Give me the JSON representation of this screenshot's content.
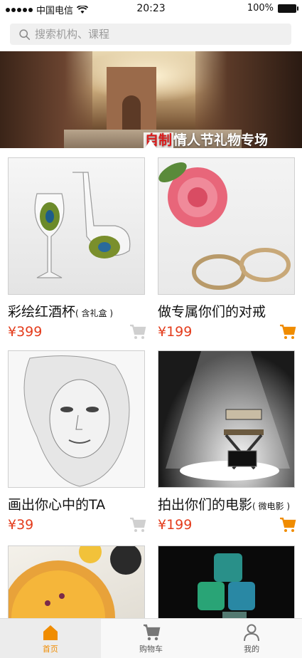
{
  "status_bar": {
    "carrier": "中国电信",
    "time": "20:23",
    "battery": "100%"
  },
  "search": {
    "placeholder": "搜索机构、课程"
  },
  "banner": {
    "title_accent": "自制",
    "title_main": "情人节礼物专场"
  },
  "products": [
    {
      "name": "彩绘红酒杯",
      "note": "( 含礼盒 )",
      "price": "¥399",
      "cart_active": false
    },
    {
      "name": "做专属你们的对戒",
      "note": "",
      "price": "¥199",
      "cart_active": true
    },
    {
      "name": "画出你心中的TA",
      "note": "",
      "price": "¥39",
      "cart_active": false
    },
    {
      "name": "拍出你们的电影",
      "note": "( 微电影 )",
      "price": "¥199",
      "cart_active": true
    },
    {
      "name": "",
      "note": "",
      "price": "",
      "cart_active": false
    },
    {
      "name": "",
      "note": "",
      "price": "",
      "cart_active": false
    }
  ],
  "tabbar": [
    {
      "label": "首页",
      "icon": "home-icon",
      "active": true
    },
    {
      "label": "购物车",
      "icon": "cart-icon",
      "active": false
    },
    {
      "label": "我的",
      "icon": "user-icon",
      "active": false
    }
  ],
  "colors": {
    "accent": "#f08c00",
    "price": "#e43c1c",
    "cart_inactive": "#d0d0d0",
    "cart_active": "#f08c00"
  }
}
